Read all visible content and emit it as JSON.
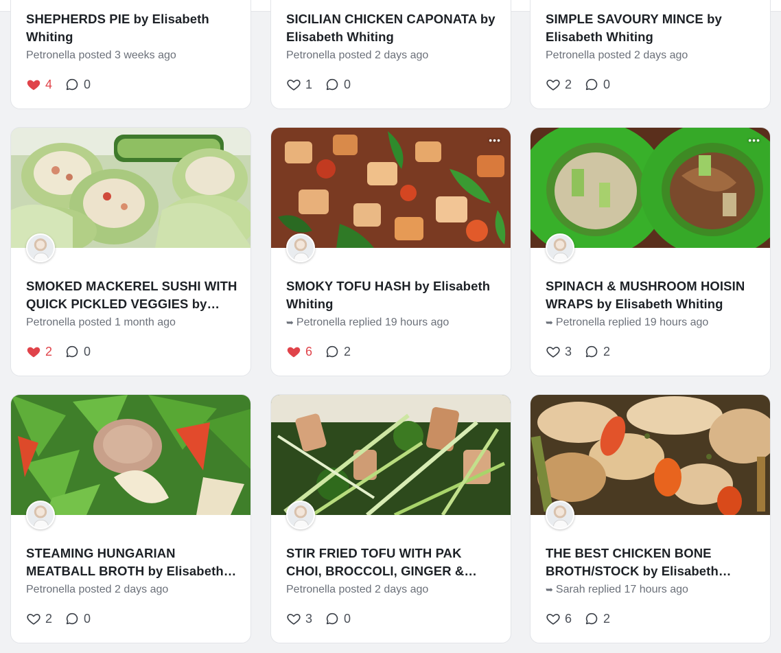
{
  "cards": [
    {
      "title": "SHEPHERDS PIE by Elisabeth Whiting",
      "meta": "Petronella posted 3 weeks ago",
      "reply": false,
      "likes": "4",
      "liked": true,
      "comments": "0"
    },
    {
      "title": "SICILIAN CHICKEN CAPONATA by Elisabeth Whiting",
      "meta": "Petronella posted 2 days ago",
      "reply": false,
      "likes": "1",
      "liked": false,
      "comments": "0"
    },
    {
      "title": "SIMPLE SAVOURY MINCE by Elisabeth Whiting",
      "meta": "Petronella posted 2 days ago",
      "reply": false,
      "likes": "2",
      "liked": false,
      "comments": "0"
    },
    {
      "title": "SMOKED MACKEREL SUSHI WITH QUICK PICKLED VEGGIES by Elisa...",
      "meta": "Petronella posted 1 month ago",
      "reply": false,
      "likes": "2",
      "liked": true,
      "comments": "0",
      "image": "cucumber-sushi-rolls-image"
    },
    {
      "title": "SMOKY TOFU HASH by Elisabeth Whiting",
      "meta": "Petronella replied 19 hours ago",
      "reply": true,
      "likes": "6",
      "liked": true,
      "comments": "2",
      "image": "tofu-hash-image"
    },
    {
      "title": "SPINACH & MUSHROOM HOISIN WRAPS by Elisabeth Whiting",
      "meta": "Petronella replied 19 hours ago",
      "reply": true,
      "likes": "3",
      "liked": false,
      "comments": "2",
      "image": "spinach-wraps-image"
    },
    {
      "title": "STEAMING HUNGARIAN MEATBALL BROTH by Elisabeth Whiting",
      "meta": "Petronella posted 2 days ago",
      "reply": false,
      "likes": "2",
      "liked": false,
      "comments": "0",
      "image": "meatball-broth-image"
    },
    {
      "title": "STIR FRIED TOFU WITH PAK CHOI, BROCCOLI, GINGER & GARLIC ...",
      "meta": "Petronella posted 2 days ago",
      "reply": false,
      "likes": "3",
      "liked": false,
      "comments": "0",
      "image": "stir-fried-tofu-image"
    },
    {
      "title": "THE BEST CHICKEN BONE BROTH/STOCK by Elisabeth Whiting",
      "meta": "Sarah replied 17 hours ago",
      "reply": true,
      "likes": "6",
      "liked": false,
      "comments": "2",
      "image": "chicken-bone-broth-image"
    }
  ],
  "colors": {
    "like_active": "#e0434a",
    "text_muted": "#6b7079",
    "card_bg": "#ffffff",
    "page_bg": "#f1f2f4"
  },
  "icons": {
    "like": "heart-icon",
    "comment": "comment-bubble-icon",
    "reply": "reply-arrow-icon",
    "more": "more-dots-icon"
  }
}
